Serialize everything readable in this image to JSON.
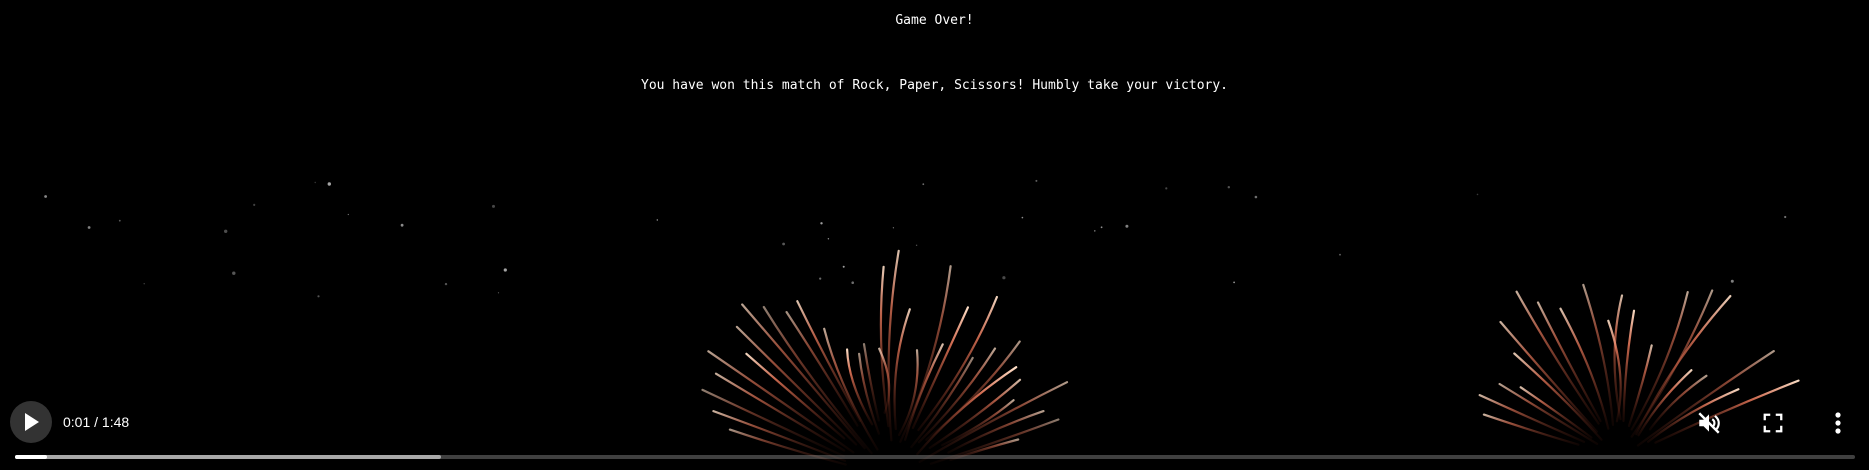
{
  "game": {
    "title": "Game Over!",
    "message": "You have won this match of Rock, Paper, Scissors! Humbly take your victory."
  },
  "video": {
    "time_display": "0:01 / 1:48",
    "current_seconds": 1,
    "duration_seconds": 108,
    "buffered_seconds": 25,
    "muted": true,
    "icons": {
      "play": "play-icon",
      "mute": "volume-muted-icon",
      "fullscreen": "fullscreen-icon",
      "more": "more-options-icon"
    },
    "colors": {
      "firework": "#e8785a",
      "firework_core": "#ffd7b8"
    }
  }
}
